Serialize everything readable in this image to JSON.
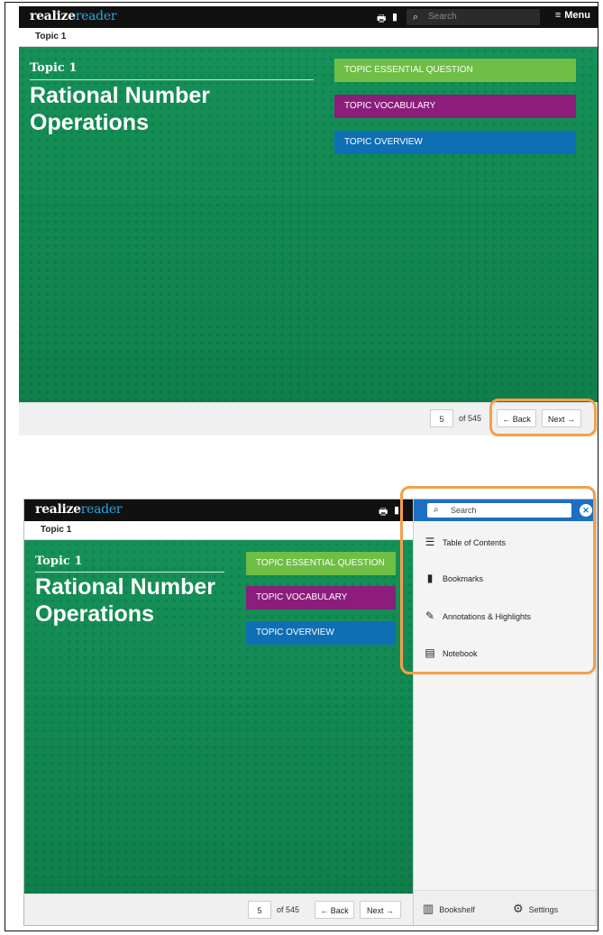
{
  "app": {
    "logo_main": "realize",
    "logo_sub": "reader",
    "search_placeholder": "Search",
    "menu_label": "Menu"
  },
  "topic_bar": "Topic 1",
  "content": {
    "topic_label": "Topic 1",
    "title_line1": "Rational Number",
    "title_line2": "Operations",
    "buttons": [
      "TOPIC ESSENTIAL QUESTION",
      "TOPIC VOCABULARY",
      "TOPIC OVERVIEW"
    ]
  },
  "pager": {
    "page": "5",
    "of_text": "of 545",
    "back": "Back",
    "next": "Next"
  },
  "side_panel": {
    "search_placeholder": "Search",
    "items": [
      "Table of Contents",
      "Bookmarks",
      "Annotations & Highlights",
      "Notebook"
    ],
    "footer": {
      "bookshelf": "Bookshelf",
      "settings": "Settings"
    }
  },
  "colors": {
    "green": "#118a52",
    "essential": "#6fbe45",
    "vocab": "#8c1d7b",
    "overview": "#0f6fb5",
    "highlight": "#f2a04a",
    "panel_header": "#1d6fc4"
  },
  "icons": [
    "print-icon",
    "bookmark-icon",
    "search-icon",
    "menu-icon",
    "list-icon",
    "pencil-icon",
    "notebook-icon",
    "bookshelf-icon",
    "gear-icon",
    "close-icon",
    "arrow-left-icon",
    "arrow-right-icon"
  ]
}
